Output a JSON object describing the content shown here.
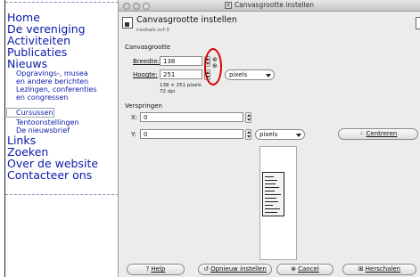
{
  "website": {
    "nav": [
      {
        "label": "Home",
        "size": "big"
      },
      {
        "label": "De vereniging",
        "size": "big"
      },
      {
        "label": "Activiteiten",
        "size": "big"
      },
      {
        "label": "Publicaties",
        "size": "big"
      },
      {
        "label": "Nieuws",
        "size": "big"
      },
      {
        "label": "Opgravings-, musea",
        "size": "small"
      },
      {
        "label": "en andere berichten",
        "size": "small"
      },
      {
        "label": "Lezingen, conferenties",
        "size": "small"
      },
      {
        "label": "en congressen",
        "size": "small"
      },
      {
        "label": "Cursussen",
        "size": "small"
      },
      {
        "label": "Tentoonstellingen",
        "size": "small"
      },
      {
        "label": "De nieuwsbrief",
        "size": "small"
      },
      {
        "label": "Links",
        "size": "big"
      },
      {
        "label": "Zoeken",
        "size": "big"
      },
      {
        "label": "Over de website",
        "size": "big"
      },
      {
        "label": "Contacteer ons",
        "size": "big"
      }
    ]
  },
  "dialog": {
    "window_title": "Canvasgrootte instellen",
    "title_icon": "close-icon",
    "header_title": "Canvasgrootte instellen",
    "header_subtitle": "navbalk.xcf-3",
    "canvas_section": "Canvasgrootte",
    "width_label": "Breedte:",
    "width_value": "138",
    "height_label": "Hoogte:",
    "height_value": "251",
    "unit_value": "pixels",
    "size_info": "138 × 251 pixels",
    "dpi_info": "72 dpi",
    "offset_section": "Verspringen",
    "x_label": "X:",
    "x_value": "0",
    "y_label": "Y:",
    "y_value": "0",
    "offset_unit": "pixels",
    "center_label": "Centreren",
    "buttons": {
      "help": "Help",
      "reset": "Opnieuw instellen",
      "cancel": "Cancel",
      "resize": "Herschalen"
    }
  },
  "colors": {
    "nav_link": "#0a1aa8",
    "highlight": "#d40000"
  }
}
